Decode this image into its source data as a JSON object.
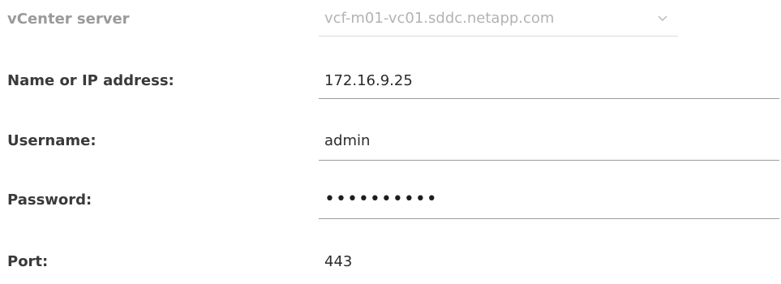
{
  "form": {
    "vcenter": {
      "label": "vCenter server",
      "value": "vcf-m01-vc01.sddc.netapp.com",
      "icon": "chevron-down-icon"
    },
    "address": {
      "label": "Name or IP address:",
      "value": "172.16.9.25"
    },
    "username": {
      "label": "Username:",
      "value": "admin"
    },
    "password": {
      "label": "Password:",
      "value": "••••••••••"
    },
    "port": {
      "label": "Port:",
      "value": "443"
    }
  },
  "colors": {
    "label": "#3a3a3a",
    "label_disabled": "#9a9a9a",
    "value_disabled": "#b3b3b3",
    "underline": "#9c9c9c"
  }
}
